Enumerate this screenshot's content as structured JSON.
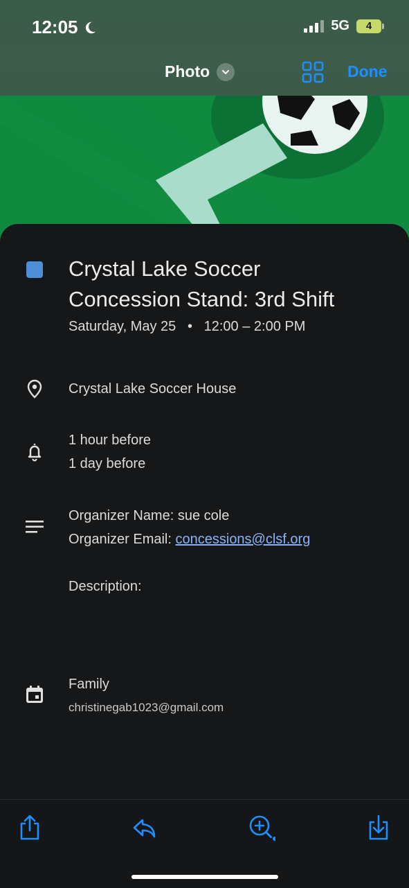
{
  "status_bar": {
    "time": "12:05",
    "network": "5G",
    "battery": "4"
  },
  "nav": {
    "title": "Photo",
    "done_label": "Done"
  },
  "event": {
    "title_line1": "Crystal Lake Soccer",
    "title_line2": "Concession Stand: 3rd Shift",
    "date": "Saturday, May 25",
    "time": "12:00 – 2:00 PM",
    "location": "Crystal Lake Soccer House",
    "reminders": [
      "1 hour before",
      "1 day before"
    ],
    "organizer_name_label": "Organizer Name: sue cole",
    "organizer_email_prefix": "Organizer Email: ",
    "organizer_email": "concessions@clsf.org",
    "description_label": "Description:",
    "calendar_name": "Family",
    "calendar_account": "christinegab1023@gmail.com",
    "color": "#4d8fd6"
  },
  "icons": {
    "location": "location-pin-icon",
    "reminder": "bell-icon",
    "notes": "notes-icon",
    "calendar": "calendar-icon"
  },
  "toolbar": [
    "share-icon",
    "reply-icon",
    "zoom-icon",
    "download-icon"
  ],
  "colors": {
    "accent": "#1f8fff",
    "link": "#8ab4f8",
    "background": "#161719"
  }
}
